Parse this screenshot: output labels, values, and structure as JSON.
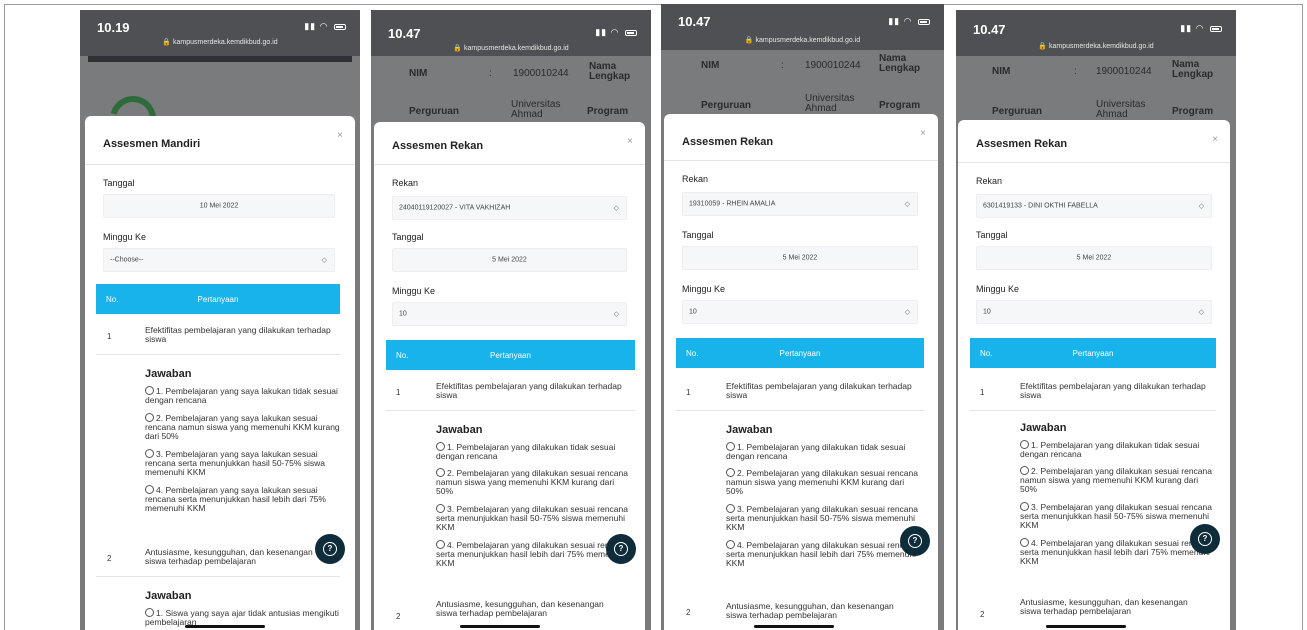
{
  "url": "kampusmerdeka.kemdikbud.go.id",
  "close_glyph": "×",
  "select_caret": "◇",
  "help_glyph": "?",
  "bg_labels": {
    "nim": "NIM",
    "colon": ":",
    "nim_value": "1900010244",
    "nama": "Nama",
    "lengkap": "Lengkap",
    "perguruan": "Perguruan",
    "universitas": "Universitas",
    "ahmad": "Ahmad",
    "program": "Program"
  },
  "table": {
    "col_no": "No.",
    "col_pertanyaan": "Pertanyaan"
  },
  "phones": [
    {
      "time": "10.19",
      "modal_title": "Assesmen Mandiri",
      "tanggal_label": "Tanggal",
      "tanggal_value": "10 Mei 2022",
      "minggu_label": "Minggu Ke",
      "minggu_value": "--Choose--",
      "q1_no": "1",
      "q1_text": "Efektifitas pembelajaran yang dilakukan terhadap siswa",
      "jawaban": "Jawaban",
      "options": [
        "1. Pembelajaran yang saya lakukan tidak sesuai dengan rencana",
        "2. Pembelajaran yang saya lakukan sesuai rencana namun siswa yang memenuhi KKM kurang dari 50%",
        "3. Pembelajaran yang saya lakukan sesuai rencana serta menunjukkan hasil 50-75% siswa memenuhi KKM",
        "4. Pembelajaran yang saya lakukan sesuai rencana serta menunjukkan hasil lebih dari 75% memenuhi KKM"
      ],
      "q2_no": "2",
      "q2_text": "Antusiasme, kesungguhan, dan kesenangan siswa terhadap pembelajaran",
      "jawaban2": "Jawaban",
      "option2_1": "1. Siswa yang saya ajar tidak antusias mengikuti pembelajaran"
    },
    {
      "time": "10.47",
      "modal_title": "Assesmen Rekan",
      "rekan_label": "Rekan",
      "rekan_value": "24040119120027 - VITA VAKHIZAH",
      "tanggal_label": "Tanggal",
      "tanggal_value": "5 Mei 2022",
      "minggu_label": "Minggu Ke",
      "minggu_value": "10",
      "q1_no": "1",
      "q1_text": "Efektifitas pembelajaran yang dilakukan terhadap siswa",
      "jawaban": "Jawaban",
      "options": [
        "1. Pembelajaran yang dilakukan tidak sesuai dengan rencana",
        "2. Pembelajaran yang dilakukan sesuai rencana namun siswa yang memenuhi KKM kurang dari 50%",
        "3. Pembelajaran yang dilakukan sesuai rencana serta menunjukkan hasil 50-75% siswa memenuhi KKM",
        "4. Pembelajaran yang dilakukan sesuai rencana serta menunjukkan hasil lebih dari 75% memenuhi KKM"
      ],
      "q2_no": "2",
      "q2_text": "Antusiasme, kesungguhan, dan kesenangan siswa terhadap pembelajaran"
    },
    {
      "time": "10.47",
      "modal_title": "Assesmen Rekan",
      "rekan_label": "Rekan",
      "rekan_value": "19310059 - RHEIN AMALIA",
      "tanggal_label": "Tanggal",
      "tanggal_value": "5 Mei 2022",
      "minggu_label": "Minggu Ke",
      "minggu_value": "10",
      "q1_no": "1",
      "q1_text": "Efektifitas pembelajaran yang dilakukan terhadap siswa",
      "jawaban": "Jawaban",
      "options": [
        "1. Pembelajaran yang dilakukan tidak sesuai dengan rencana",
        "2. Pembelajaran yang dilakukan sesuai rencana namun siswa yang memenuhi KKM kurang dari 50%",
        "3. Pembelajaran yang dilakukan sesuai rencana serta menunjukkan hasil 50-75% siswa memenuhi KKM",
        "4. Pembelajaran yang dilakukan sesuai rencana serta menunjukkan hasil lebih dari 75% memenuhi KKM"
      ],
      "q2_no": "2",
      "q2_text": "Antusiasme, kesungguhan, dan kesenangan siswa terhadap pembelajaran"
    },
    {
      "time": "10.47",
      "modal_title": "Assesmen Rekan",
      "rekan_label": "Rekan",
      "rekan_value": "6301419133 - DINI OKTHI FABELLA",
      "tanggal_label": "Tanggal",
      "tanggal_value": "5 Mei 2022",
      "minggu_label": "Minggu Ke",
      "minggu_value": "10",
      "q1_no": "1",
      "q1_text": "Efektifitas pembelajaran yang dilakukan terhadap siswa",
      "jawaban": "Jawaban",
      "options": [
        "1. Pembelajaran yang dilakukan tidak sesuai dengan rencana",
        "2. Pembelajaran yang dilakukan sesuai rencana namun siswa yang memenuhi KKM kurang dari 50%",
        "3. Pembelajaran yang dilakukan sesuai rencana serta menunjukkan hasil 50-75% siswa memenuhi KKM",
        "4. Pembelajaran yang dilakukan sesuai rencana serta menunjukkan hasil lebih dari 75% memenuhi KKM"
      ],
      "q2_no": "2",
      "q2_text": "Antusiasme, kesungguhan, dan kesenangan siswa terhadap pembelajaran"
    }
  ]
}
